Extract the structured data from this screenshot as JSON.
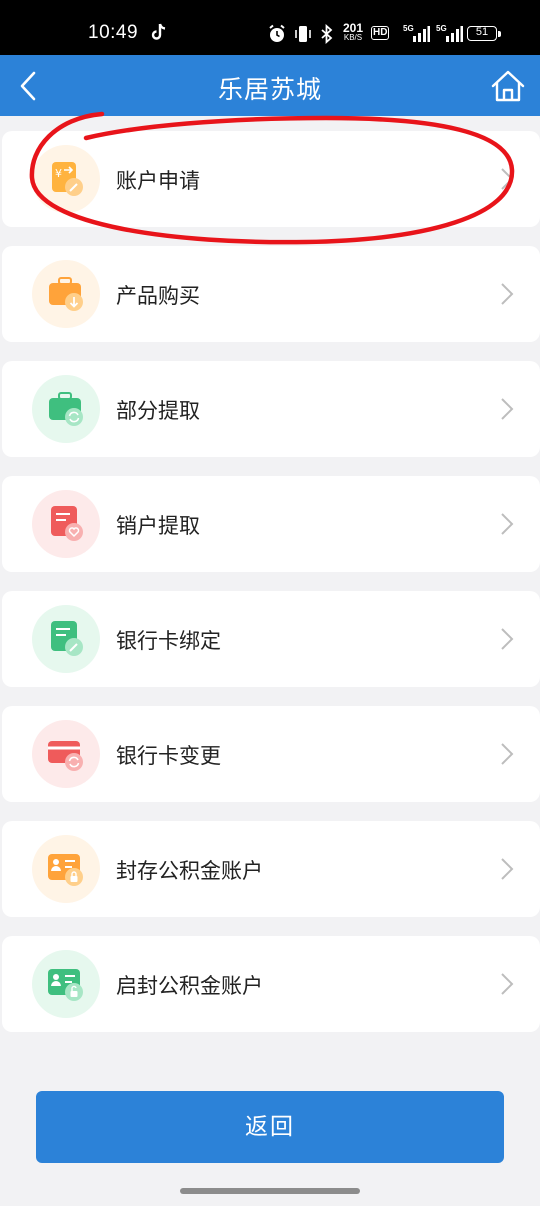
{
  "status_bar": {
    "time": "10:49",
    "net_speed_value": "201",
    "net_speed_unit": "KB/S",
    "hd_label": "HD",
    "network1": "5G",
    "network2": "5G",
    "battery": "51",
    "icons": [
      "tiktok-icon",
      "alarm-icon",
      "vibrate-icon",
      "bluetooth-icon",
      "signal-icon",
      "battery-icon"
    ]
  },
  "nav": {
    "title": "乐居苏城",
    "back_icon": "chevron-left-icon",
    "home_icon": "home-icon"
  },
  "menu": {
    "items": [
      {
        "label": "账户申请",
        "icon": "account-apply-icon",
        "color": "#ffa33a"
      },
      {
        "label": "产品购买",
        "icon": "product-purchase-icon",
        "color": "#ffa33a"
      },
      {
        "label": "部分提取",
        "icon": "partial-withdraw-icon",
        "color": "#3fbf7f"
      },
      {
        "label": "销户提取",
        "icon": "close-account-withdraw-icon",
        "color": "#ef5b5b"
      },
      {
        "label": "银行卡绑定",
        "icon": "bank-card-bind-icon",
        "color": "#3fbf7f"
      },
      {
        "label": "银行卡变更",
        "icon": "bank-card-change-icon",
        "color": "#ef5b5b"
      },
      {
        "label": "封存公积金账户",
        "icon": "seal-fund-account-icon",
        "color": "#ffa33a"
      },
      {
        "label": "启封公积金账户",
        "icon": "unseal-fund-account-icon",
        "color": "#3fbf7f"
      }
    ]
  },
  "annotation": {
    "color": "#e8141a"
  },
  "footer": {
    "return_label": "返回"
  }
}
